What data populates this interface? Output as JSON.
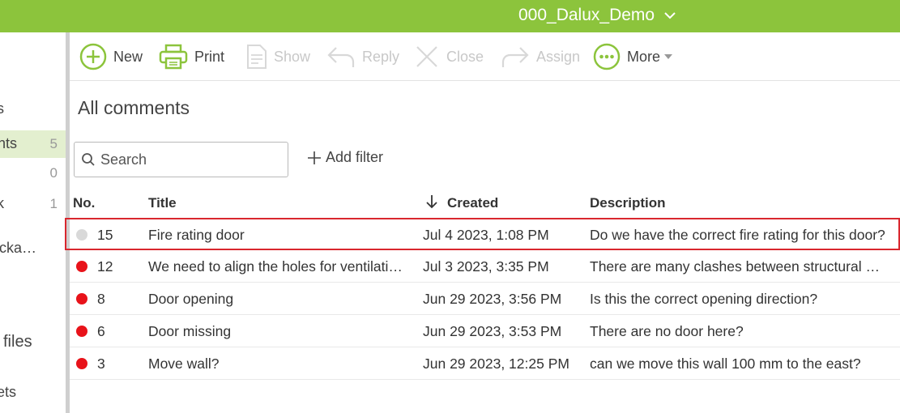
{
  "header": {
    "project_name": "000_Dalux_Demo",
    "bar_color": "#8cc43c"
  },
  "sidebar": {
    "items": [
      {
        "label": "s",
        "count": ""
      },
      {
        "label": "nts",
        "count": "5",
        "active": true
      },
      {
        "label": "",
        "count": "0"
      },
      {
        "label": "k",
        "count": "1"
      },
      {
        "label": "cka…",
        "count": ""
      },
      {
        "label": "files",
        "count": ""
      },
      {
        "label": "ets",
        "count": ""
      }
    ]
  },
  "toolbar": {
    "new": "New",
    "print": "Print",
    "show": "Show",
    "reply": "Reply",
    "close": "Close",
    "assign": "Assign",
    "more": "More"
  },
  "main": {
    "title": "All comments",
    "search_placeholder": "Search",
    "add_filter": "Add filter"
  },
  "table": {
    "columns": {
      "no": "No.",
      "title": "Title",
      "created": "Created",
      "description": "Description"
    },
    "rows": [
      {
        "no": "15",
        "title": "Fire rating door",
        "created": "Jul 4 2023, 1:08 PM",
        "description": "Do we have the correct fire rating for this door?",
        "status_color": "#d9d9d9"
      },
      {
        "no": "12",
        "title": "We need to align the holes for ventilatio…",
        "created": "Jul 3 2023, 3:35 PM",
        "description": "There are many clashes between structural w…",
        "status_color": "#e8131a"
      },
      {
        "no": "8",
        "title": "Door opening",
        "created": "Jun 29 2023, 3:56 PM",
        "description": "Is this the correct opening direction?",
        "status_color": "#e8131a"
      },
      {
        "no": "6",
        "title": "Door missing",
        "created": "Jun 29 2023, 3:53 PM",
        "description": "There are no door here?",
        "status_color": "#e8131a"
      },
      {
        "no": "3",
        "title": "Move wall?",
        "created": "Jun 29 2023, 12:25 PM",
        "description": "can we move this wall 100 mm to the east?",
        "status_color": "#e8131a"
      }
    ]
  }
}
